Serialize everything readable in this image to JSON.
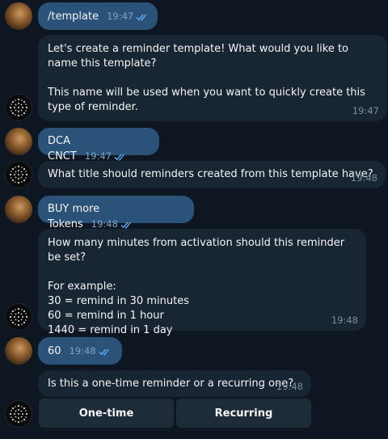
{
  "messages": [
    {
      "text": "/template",
      "time": "19:47"
    },
    {
      "text": "Let's create a reminder template! What would you like to name this template?\n\nThis name will be used when you want to quickly create this type of reminder.",
      "time": "19:47"
    },
    {
      "text": "DCA CNCT",
      "time": "19:47"
    },
    {
      "text": "What title should reminders created from this template have?",
      "time": "19:48"
    },
    {
      "text": "BUY more Tokens",
      "time": "19:48"
    },
    {
      "text": "How many minutes from activation should this reminder be set?\n\nFor example:\n30 = remind in 30 minutes\n60 = remind in 1 hour\n1440 = remind in 1 day",
      "time": "19:48"
    },
    {
      "text": "60",
      "time": "19:48"
    },
    {
      "text": "Is this a one-time reminder or a recurring one?",
      "time": "19:48"
    }
  ],
  "inline_buttons": {
    "one_time": "One-time",
    "recurring": "Recurring"
  },
  "icons": {
    "read_receipt": "double-check-icon",
    "bot_avatar": "dotted-globe-icon",
    "user_avatar": "user-photo-avatar"
  },
  "colors": {
    "background": "#0e1621",
    "outgoing_bubble": "#2b5278",
    "incoming_bubble": "#182533",
    "inline_button": "#1e2c3a",
    "read_tick": "#5fb0ff"
  }
}
